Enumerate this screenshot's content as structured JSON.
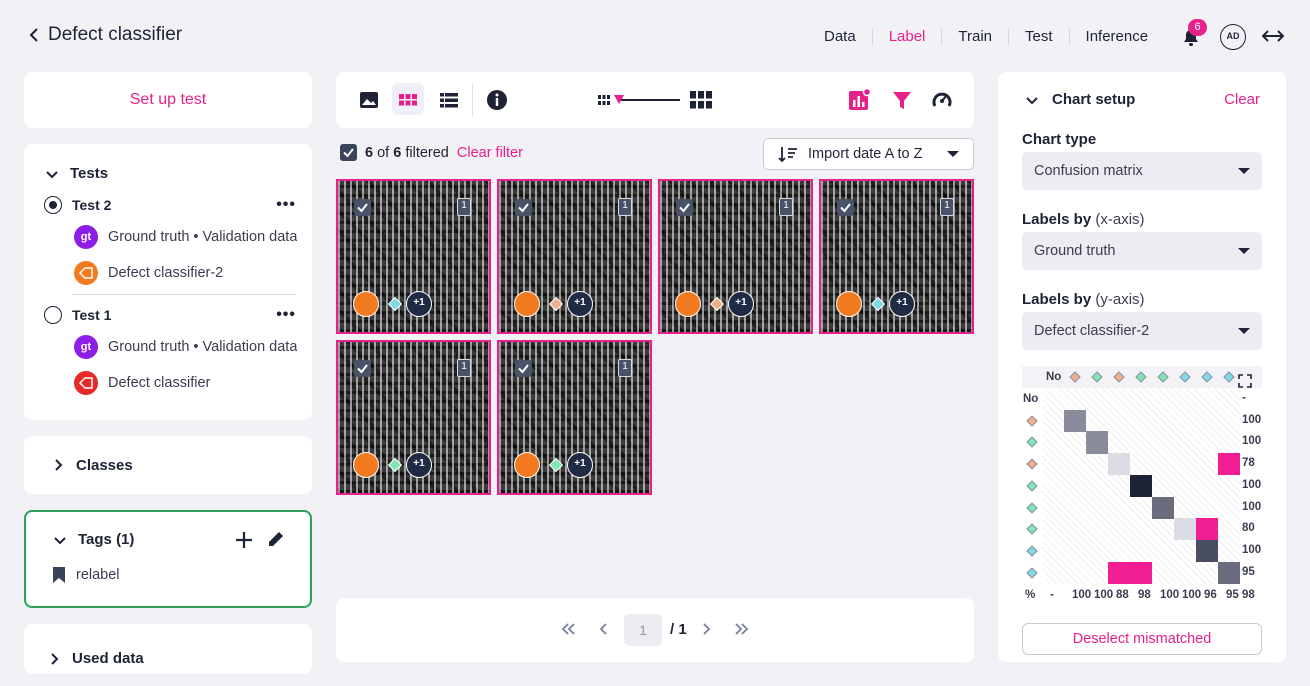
{
  "app": {
    "title": "Defect classifier"
  },
  "nav": [
    {
      "label": "Data",
      "active": false
    },
    {
      "label": "Label",
      "active": true
    },
    {
      "label": "Train",
      "active": false
    },
    {
      "label": "Test",
      "active": false
    },
    {
      "label": "Inference",
      "active": false
    }
  ],
  "notifications": {
    "count": "6"
  },
  "user": {
    "initials": "AD"
  },
  "left": {
    "setup_test": "Set up test",
    "tests_title": "Tests",
    "tests": [
      {
        "name": "Test 2",
        "selected": true,
        "items": [
          {
            "chip": "gt",
            "label": "Ground truth • Validation data"
          },
          {
            "chip": "orange",
            "label": "Defect classifier-2"
          }
        ]
      },
      {
        "name": "Test 1",
        "selected": false,
        "items": [
          {
            "chip": "gt",
            "label": "Ground truth • Validation data"
          },
          {
            "chip": "red",
            "label": "Defect classifier"
          }
        ]
      }
    ],
    "chip_gt_text": "gt",
    "classes_title": "Classes",
    "tags_title": "Tags (1)",
    "tags": [
      "relabel"
    ],
    "used_data_title": "Used data"
  },
  "center": {
    "filter": {
      "count": "6",
      "of": "of",
      "total": "6",
      "suffix": "filtered",
      "clear": "Clear filter"
    },
    "sort_label": "Import date A to Z",
    "thumb_count_label": "1",
    "thumb_plus_label": "+1",
    "thumbs": [
      {
        "diamond": "#7fd9e6"
      },
      {
        "diamond": "#f0b08a"
      },
      {
        "diamond": "#f0b08a"
      },
      {
        "diamond": "#7fd9e6"
      },
      {
        "diamond": "#7fe6b4"
      },
      {
        "diamond": "#7fe6b4"
      }
    ],
    "pager": {
      "page": "1",
      "total": "/ 1"
    }
  },
  "right": {
    "title": "Chart setup",
    "clear": "Clear",
    "chart_type_label": "Chart type",
    "chart_type_value": "Confusion matrix",
    "x_label": "Labels by",
    "x_axis": "(x-axis)",
    "x_value": "Ground truth",
    "y_label": "Labels by",
    "y_axis": "(y-axis)",
    "y_value": "Defect classifier-2",
    "matrix": {
      "no_label": "No",
      "row_colors": [
        "#f0b08a",
        "#7fe6b4",
        "#f0b08a",
        "#7fe6b4",
        "#7fe6b4",
        "#7fe6b4",
        "#7fd9e6",
        "#7fd9e6"
      ],
      "col_colors": [
        "#f0b08a",
        "#7fe6b4",
        "#f0b08a",
        "#7fe6b4",
        "#7fe6b4",
        "#7fd9e6",
        "#7fd9e6",
        "#7fd9e6"
      ],
      "row_values": [
        "-",
        "100",
        "100",
        "78",
        "100",
        "100",
        "80",
        "100",
        "95"
      ],
      "col_values": [
        "-",
        "100",
        "100",
        "88",
        "98",
        "100",
        "100",
        "96",
        "95"
      ],
      "corner": "%",
      "total": "98",
      "cells": [
        {
          "r": 1,
          "c": 1,
          "color": "#8a8c9c"
        },
        {
          "r": 2,
          "c": 2,
          "color": "#8a8c9c"
        },
        {
          "r": 3,
          "c": 3,
          "color": "#dcdce4"
        },
        {
          "r": 3,
          "c": 8,
          "color": "#f21f94"
        },
        {
          "r": 4,
          "c": 4,
          "color": "#1f2336"
        },
        {
          "r": 5,
          "c": 5,
          "color": "#6a6c7e"
        },
        {
          "r": 6,
          "c": 6,
          "color": "#dcdce4"
        },
        {
          "r": 6,
          "c": 7,
          "color": "#f21f94"
        },
        {
          "r": 7,
          "c": 7,
          "color": "#4a4e62"
        },
        {
          "r": 8,
          "c": 3,
          "color": "#f21f94"
        },
        {
          "r": 8,
          "c": 4,
          "color": "#f21f94"
        },
        {
          "r": 8,
          "c": 8,
          "color": "#6a6c7e"
        }
      ]
    },
    "deselect": "Deselect mismatched"
  }
}
